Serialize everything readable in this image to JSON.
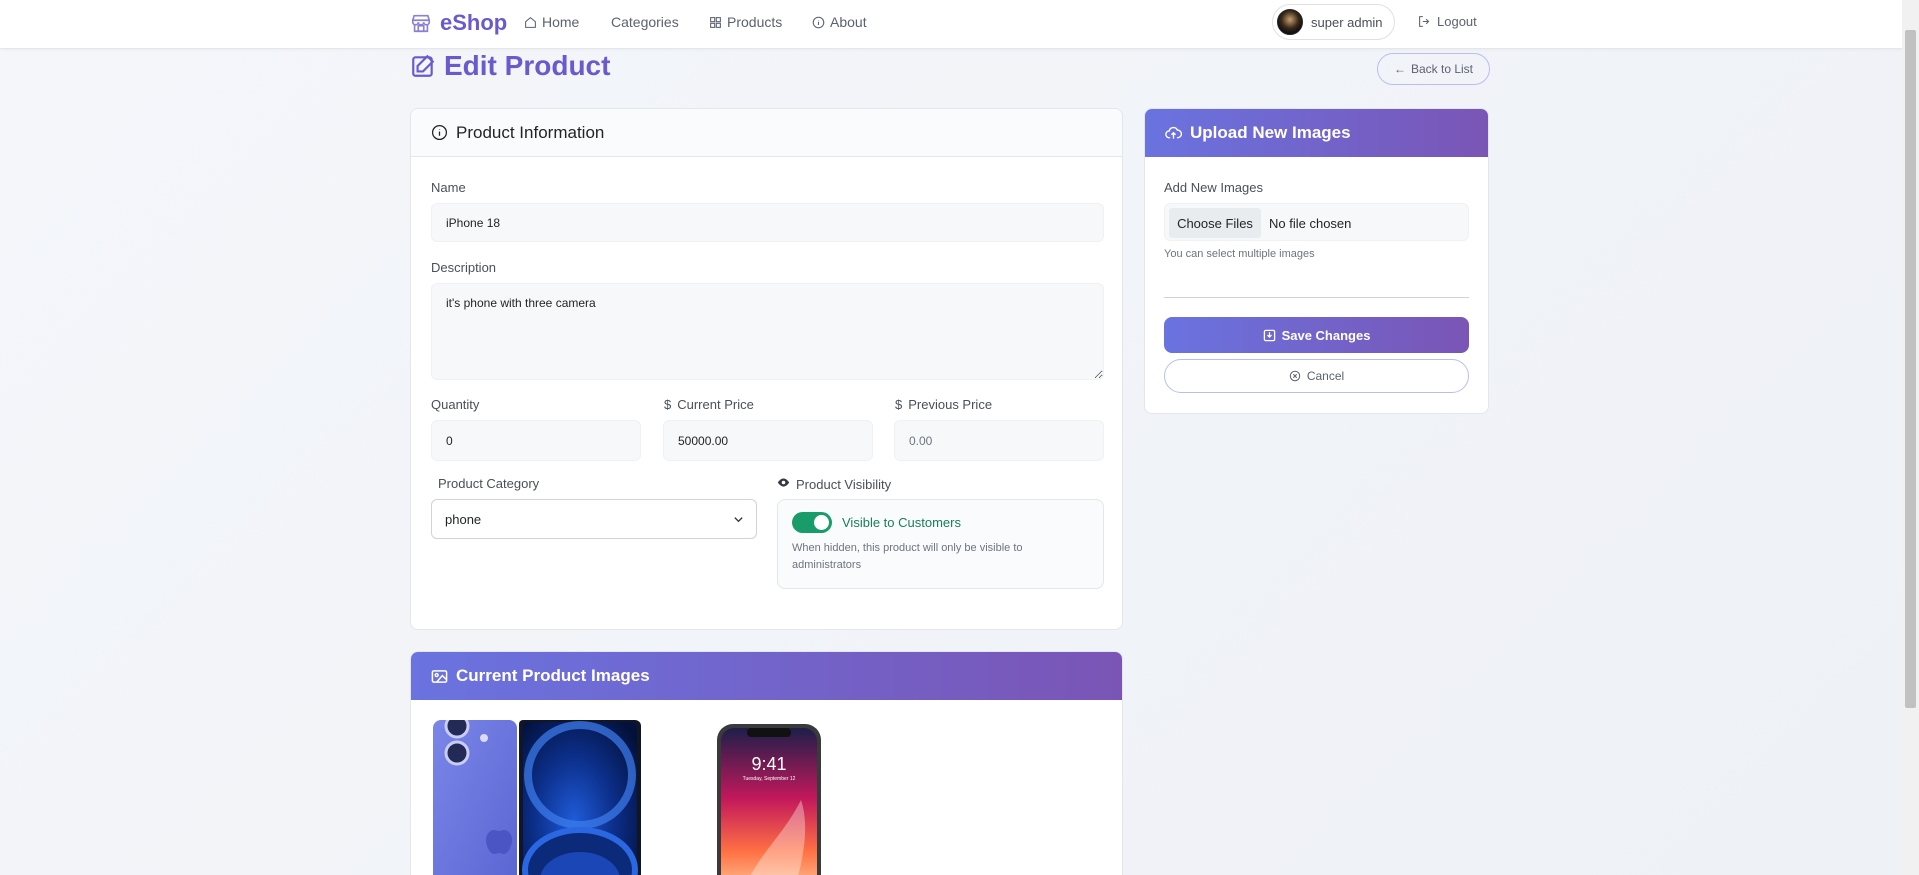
{
  "nav": {
    "brand": "eShop",
    "links": [
      "Home",
      "Categories",
      "Products",
      "About"
    ],
    "user": "super admin",
    "logout": "Logout"
  },
  "page": {
    "title": "Edit Product",
    "back": "Back to List"
  },
  "info_card": {
    "title": "Product Information",
    "name_label": "Name",
    "name_value": "iPhone 18",
    "description_label": "Description",
    "description_value": "it's phone with three camera",
    "quantity_label": "Quantity",
    "quantity_value": "0",
    "current_price_label": "Current Price",
    "current_price_value": "50000.00",
    "previous_price_label": "Previous Price",
    "previous_price_placeholder": "0.00",
    "currency_symbol": "$",
    "category_label": "Product Category",
    "category_value": "phone",
    "visibility_label": "Product Visibility",
    "visibility_toggle_label": "Visible to Customers",
    "visibility_on": true,
    "visibility_help": "When hidden, this product will only be visible to administrators"
  },
  "upload_card": {
    "title": "Upload New Images",
    "add_label": "Add New Images",
    "choose_button": "Choose Files",
    "file_status": "No file chosen",
    "hint": "You can select multiple images",
    "save": "Save Changes",
    "cancel": "Cancel"
  },
  "images_card": {
    "title": "Current Product Images",
    "images": [
      {
        "alt": "iPhone 18 blue"
      },
      {
        "alt": "iPhone X"
      }
    ]
  },
  "colors": {
    "accent": "#6a5acd",
    "gradient_start": "#6a73e0",
    "gradient_end": "#7a55b5",
    "toggle_on": "#1a9c6a"
  }
}
